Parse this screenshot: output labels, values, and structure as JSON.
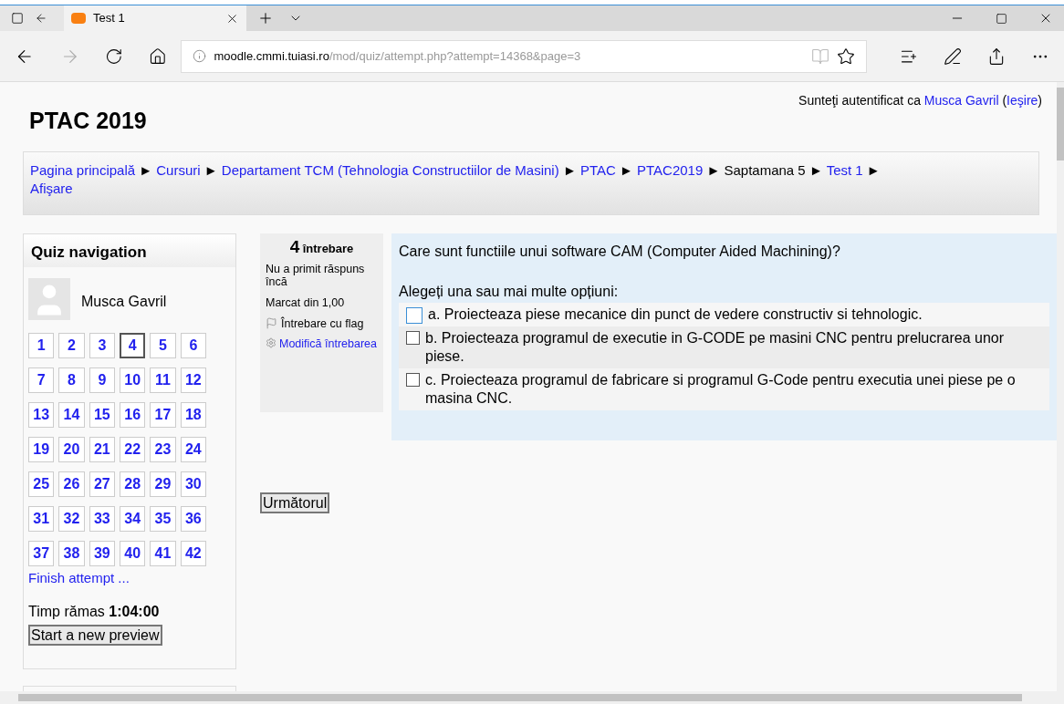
{
  "browser": {
    "tab": {
      "title": "Test 1"
    },
    "address": {
      "domain": "moodle.cmmi.tuiasi.ro",
      "path": "/mod/quiz/attempt.php?attempt=14368&page=3"
    }
  },
  "header": {
    "title": "PTAC 2019",
    "login": {
      "prefix": "Sunteţi autentificat ca",
      "user": "Musca Gavril",
      "open": "(",
      "logout": "Ieşire",
      "close": ")"
    }
  },
  "breadcrumb": [
    {
      "text": "Pagina principală",
      "link": true
    },
    {
      "text": "Cursuri",
      "link": true
    },
    {
      "text": "Departament TCM (Tehnologia Constructiilor de Masini)",
      "link": true
    },
    {
      "text": "PTAC",
      "link": true
    },
    {
      "text": "PTAC2019",
      "link": true
    },
    {
      "text": "Saptamana 5",
      "link": false
    },
    {
      "text": "Test 1",
      "link": true
    },
    {
      "text": "Afişare",
      "link": true
    }
  ],
  "separator": "►",
  "quiz_nav": {
    "title": "Quiz navigation",
    "user": "Musca Gavril",
    "questions": [
      {
        "n": "1",
        "selected": false
      },
      {
        "n": "2",
        "selected": false
      },
      {
        "n": "3",
        "selected": false
      },
      {
        "n": "4",
        "selected": true
      },
      {
        "n": "5",
        "selected": false
      },
      {
        "n": "6",
        "selected": false
      },
      {
        "n": "7",
        "selected": false
      },
      {
        "n": "8",
        "selected": false
      },
      {
        "n": "9",
        "selected": false
      },
      {
        "n": "10",
        "selected": false
      },
      {
        "n": "11",
        "selected": false
      },
      {
        "n": "12",
        "selected": false
      },
      {
        "n": "13",
        "selected": false
      },
      {
        "n": "14",
        "selected": false
      },
      {
        "n": "15",
        "selected": false
      },
      {
        "n": "16",
        "selected": false
      },
      {
        "n": "17",
        "selected": false
      },
      {
        "n": "18",
        "selected": false
      },
      {
        "n": "19",
        "selected": false
      },
      {
        "n": "20",
        "selected": false
      },
      {
        "n": "21",
        "selected": false
      },
      {
        "n": "22",
        "selected": false
      },
      {
        "n": "23",
        "selected": false
      },
      {
        "n": "24",
        "selected": false
      },
      {
        "n": "25",
        "selected": false
      },
      {
        "n": "26",
        "selected": false
      },
      {
        "n": "27",
        "selected": false
      },
      {
        "n": "28",
        "selected": false
      },
      {
        "n": "29",
        "selected": false
      },
      {
        "n": "30",
        "selected": false
      },
      {
        "n": "31",
        "selected": false
      },
      {
        "n": "32",
        "selected": false
      },
      {
        "n": "33",
        "selected": false
      },
      {
        "n": "34",
        "selected": false
      },
      {
        "n": "35",
        "selected": false
      },
      {
        "n": "36",
        "selected": false
      },
      {
        "n": "37",
        "selected": false
      },
      {
        "n": "38",
        "selected": false
      },
      {
        "n": "39",
        "selected": false
      },
      {
        "n": "40",
        "selected": false
      },
      {
        "n": "41",
        "selected": false
      },
      {
        "n": "42",
        "selected": false
      }
    ],
    "finish": "Finish attempt ...",
    "timer_label": "Timp rămas",
    "timer": "1:04:00",
    "new_preview": "Start a new preview"
  },
  "question_info": {
    "number": "4",
    "label": "întrebare",
    "status": "Nu a primit răspuns încă",
    "mark": "Marcat din 1,00",
    "flag": "Întrebare cu flag",
    "edit": "Modifică întrebarea"
  },
  "question": {
    "text": "Care sunt functiile unui software CAM (Computer Aided Machining)?",
    "prompt": "Alegeți una sau mai multe opțiuni:",
    "answers": [
      {
        "text": "a. Proiecteaza piese mecanice din punct de vedere constructiv si tehnologic.",
        "checked": false,
        "selected": true
      },
      {
        "text": "b. Proiecteaza programul de executie in G-CODE pe masini CNC pentru prelucrarea unor piese.",
        "checked": false,
        "selected": false
      },
      {
        "text": "c. Proiecteaza programul de fabricare si programul G-Code pentru executia unei piese pe o masina CNC.",
        "checked": false,
        "selected": false
      }
    ]
  },
  "next_button": "Următorul"
}
